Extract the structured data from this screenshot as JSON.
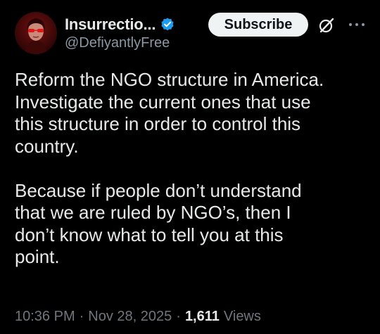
{
  "author": {
    "display_name": "Insurrectio...",
    "handle": "@DefiyantlyFree",
    "avatar_icon": "avatar-portrait",
    "verified_icon": "verified-badge-icon",
    "verified_color": "#1d9bf0"
  },
  "header": {
    "subscribe_label": "Subscribe",
    "grok_icon": "grok-icon",
    "more_icon": "more-options-icon"
  },
  "tweet": {
    "paragraphs": [
      "Reform the NGO structure in America.\nInvestigate the current ones that use\nthis structure in order to control this\ncountry.",
      "Because if people don’t understand\nthat we are ruled by NGO’s, then I\ndon’t know what to tell you at this\npoint."
    ]
  },
  "meta": {
    "time": "10:36 PM",
    "separator": "·",
    "date": "Nov 28, 2025",
    "views_count": "1,611",
    "views_label": "Views"
  },
  "colors": {
    "background": "#000000",
    "primary_text": "#e7e9ea",
    "secondary_text": "#71767b",
    "subscribe_bg": "#eff3f4"
  }
}
